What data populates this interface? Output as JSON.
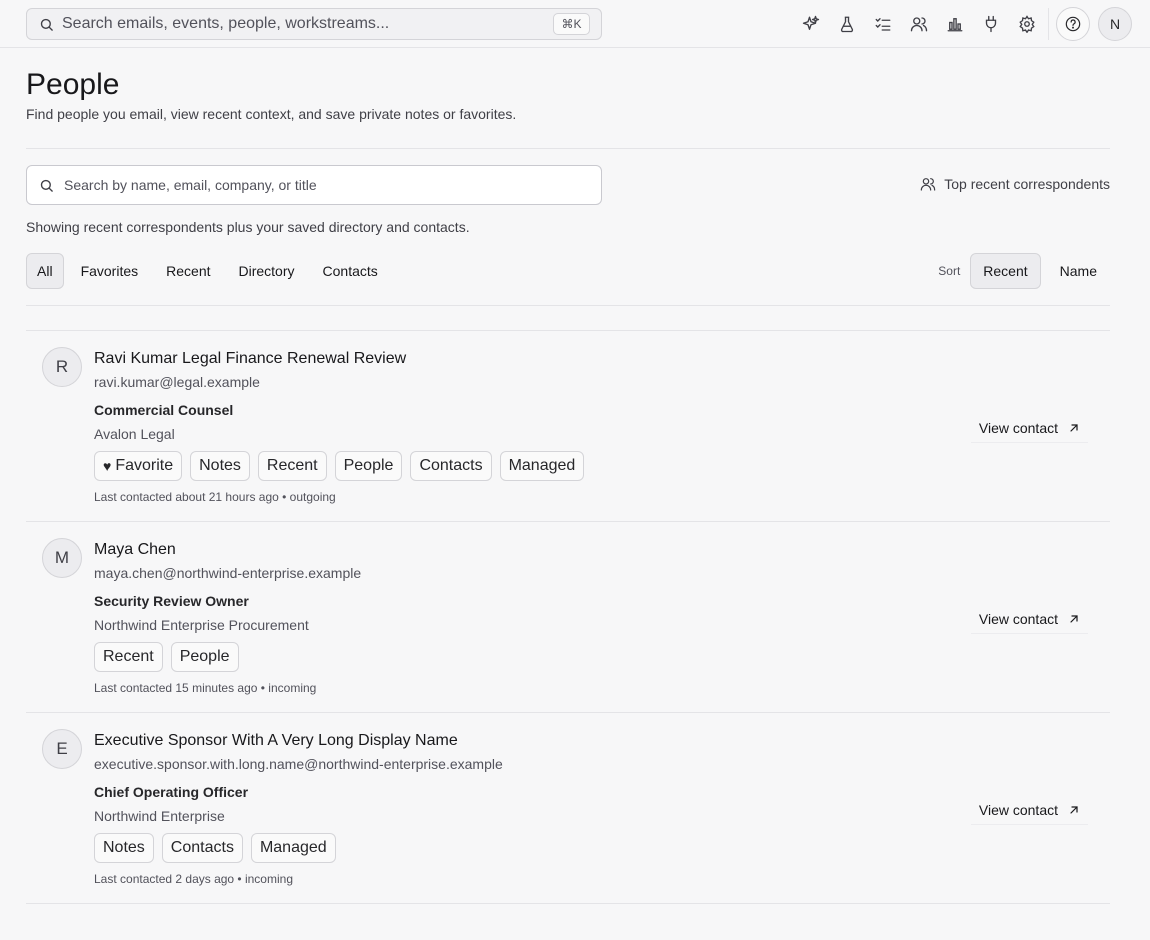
{
  "topbar": {
    "search_placeholder": "Search emails, events, people, workstreams...",
    "shortcut": "⌘K",
    "tools": [
      "sparkle-icon",
      "flask-icon",
      "task-list-icon",
      "people-icon",
      "chart-icon",
      "plug-icon",
      "gear-icon"
    ],
    "help_icon": "help-icon",
    "avatar_initial": "N"
  },
  "header": {
    "title": "People",
    "subtitle": "Find people you email, view recent context, and save private notes or favorites."
  },
  "search": {
    "placeholder": "Search by name, email, company, or title",
    "top_recent_label": "Top recent correspondents",
    "showing_text": "Showing recent correspondents plus your saved directory and contacts."
  },
  "filters": {
    "tabs": [
      "All",
      "Favorites",
      "Recent",
      "Directory",
      "Contacts"
    ],
    "active": "All",
    "sort_label": "Sort",
    "sort_options": [
      "Recent",
      "Name"
    ],
    "sort_active": "Recent"
  },
  "people": [
    {
      "initial": "R",
      "name": "Ravi Kumar Legal Finance Renewal Review",
      "email": "ravi.kumar@legal.example",
      "title": "Commercial Counsel",
      "company": "Avalon Legal",
      "favorite_label": "Favorite",
      "tags": [
        "Notes",
        "Recent",
        "People",
        "Contacts",
        "Managed"
      ],
      "last_contacted": "Last contacted about 21 hours ago • outgoing",
      "action": "View contact"
    },
    {
      "initial": "M",
      "name": "Maya Chen",
      "email": "maya.chen@northwind-enterprise.example",
      "title": "Security Review Owner",
      "company": "Northwind Enterprise Procurement",
      "favorite_label": null,
      "tags": [
        "Recent",
        "People"
      ],
      "last_contacted": "Last contacted 15 minutes ago • incoming",
      "action": "View contact"
    },
    {
      "initial": "E",
      "name": "Executive Sponsor With A Very Long Display Name",
      "email": "executive.sponsor.with.long.name@northwind-enterprise.example",
      "title": "Chief Operating Officer",
      "company": "Northwind Enterprise",
      "favorite_label": null,
      "tags": [
        "Notes",
        "Contacts",
        "Managed"
      ],
      "last_contacted": "Last contacted 2 days ago • incoming",
      "action": "View contact"
    }
  ]
}
